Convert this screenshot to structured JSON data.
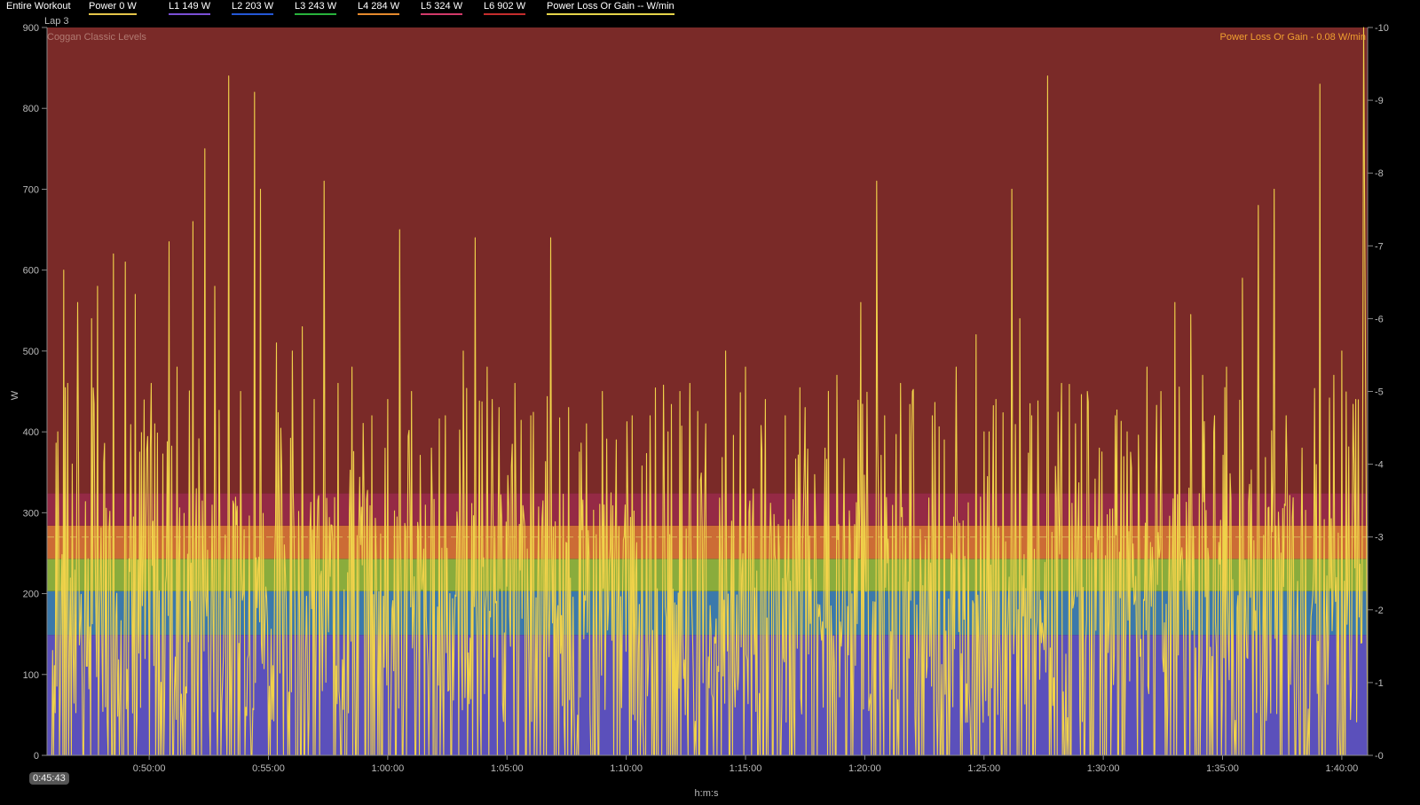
{
  "legend": {
    "title": "Entire Workout",
    "items": [
      {
        "label": "Power  0 W",
        "color": "#e5c54a"
      },
      {
        "label": "L1  149 W",
        "color": "#7a4fd6"
      },
      {
        "label": "L2  203 W",
        "color": "#2457d6"
      },
      {
        "label": "L3  243 W",
        "color": "#28b33c"
      },
      {
        "label": "L4  284 W",
        "color": "#e58a2d"
      },
      {
        "label": "L5  324 W",
        "color": "#d23a6a"
      },
      {
        "label": "L6  902 W",
        "color": "#c52d2d"
      },
      {
        "label": "Power Loss Or Gain  -- W/min",
        "color": "#e5d44a"
      }
    ]
  },
  "lap_label": "Lap 3",
  "zone_scheme_label": "Coggan Classic Levels",
  "secondary_label": "Power Loss Or Gain - 0.08 W/min",
  "cursor_time": "0:45:43",
  "chart_data": {
    "type": "line",
    "title": "",
    "xlabel": "h:m:s",
    "ylabel": "W",
    "xlim_seconds": [
      2743,
      6065
    ],
    "ylim": [
      0,
      900
    ],
    "y2lim": [
      0,
      10
    ],
    "yticks": [
      "0",
      "100",
      "200",
      "300",
      "400",
      "500",
      "600",
      "700",
      "800",
      "900"
    ],
    "y2ticks": [
      "0",
      "1",
      "2",
      "3",
      "4",
      "5",
      "6",
      "7",
      "8",
      "9",
      "10"
    ],
    "xticks": [
      {
        "label": "0:50:00",
        "t": 3000
      },
      {
        "label": "0:55:00",
        "t": 3300
      },
      {
        "label": "1:00:00",
        "t": 3600
      },
      {
        "label": "1:05:00",
        "t": 3900
      },
      {
        "label": "1:10:00",
        "t": 4200
      },
      {
        "label": "1:15:00",
        "t": 4500
      },
      {
        "label": "1:20:00",
        "t": 4800
      },
      {
        "label": "1:25:00",
        "t": 5100
      },
      {
        "label": "1:30:00",
        "t": 5400
      },
      {
        "label": "1:35:00",
        "t": 5700
      },
      {
        "label": "1:40:00",
        "t": 6000
      }
    ],
    "zones": [
      {
        "name": "L1",
        "from": 0,
        "to": 149,
        "color": "#5b50bb"
      },
      {
        "name": "L2",
        "from": 149,
        "to": 203,
        "color": "#3b79ab"
      },
      {
        "name": "L3",
        "from": 203,
        "to": 243,
        "color": "#8aac3c"
      },
      {
        "name": "L4",
        "from": 243,
        "to": 284,
        "color": "#cc6c35"
      },
      {
        "name": "L5",
        "from": 284,
        "to": 324,
        "color": "#952a45"
      },
      {
        "name": "L6",
        "from": 324,
        "to": 900,
        "color": "#7a2a28"
      }
    ],
    "reference_line": 270,
    "series": [
      {
        "name": "Power",
        "color": "#f0d24a",
        "peaks": [
          {
            "t": 2755,
            "v": 0
          },
          {
            "t": 2770,
            "v": 400
          },
          {
            "t": 2785,
            "v": 600
          },
          {
            "t": 2795,
            "v": 460
          },
          {
            "t": 2820,
            "v": 560
          },
          {
            "t": 2855,
            "v": 540
          },
          {
            "t": 2870,
            "v": 580
          },
          {
            "t": 2910,
            "v": 620
          },
          {
            "t": 2940,
            "v": 610
          },
          {
            "t": 2965,
            "v": 570
          },
          {
            "t": 3005,
            "v": 460
          },
          {
            "t": 3050,
            "v": 635
          },
          {
            "t": 3070,
            "v": 480
          },
          {
            "t": 3110,
            "v": 660
          },
          {
            "t": 3140,
            "v": 750
          },
          {
            "t": 3165,
            "v": 580
          },
          {
            "t": 3200,
            "v": 840
          },
          {
            "t": 3230,
            "v": 450
          },
          {
            "t": 3265,
            "v": 820
          },
          {
            "t": 3280,
            "v": 700
          },
          {
            "t": 3320,
            "v": 510
          },
          {
            "t": 3360,
            "v": 500
          },
          {
            "t": 3385,
            "v": 530
          },
          {
            "t": 3415,
            "v": 440
          },
          {
            "t": 3440,
            "v": 710
          },
          {
            "t": 3475,
            "v": 460
          },
          {
            "t": 3510,
            "v": 480
          },
          {
            "t": 3560,
            "v": 420
          },
          {
            "t": 3600,
            "v": 440
          },
          {
            "t": 3630,
            "v": 650
          },
          {
            "t": 3660,
            "v": 450
          },
          {
            "t": 3710,
            "v": 380
          },
          {
            "t": 3745,
            "v": 420
          },
          {
            "t": 3790,
            "v": 500
          },
          {
            "t": 3820,
            "v": 640
          },
          {
            "t": 3850,
            "v": 480
          },
          {
            "t": 3880,
            "v": 430
          },
          {
            "t": 3920,
            "v": 460
          },
          {
            "t": 3960,
            "v": 420
          },
          {
            "t": 4010,
            "v": 640
          },
          {
            "t": 4055,
            "v": 430
          },
          {
            "t": 4100,
            "v": 410
          },
          {
            "t": 4140,
            "v": 450
          },
          {
            "t": 4175,
            "v": 390
          },
          {
            "t": 4215,
            "v": 420
          },
          {
            "t": 4260,
            "v": 420
          },
          {
            "t": 4305,
            "v": 400
          },
          {
            "t": 4335,
            "v": 450
          },
          {
            "t": 4360,
            "v": 460
          },
          {
            "t": 4400,
            "v": 410
          },
          {
            "t": 4450,
            "v": 500
          },
          {
            "t": 4500,
            "v": 480
          },
          {
            "t": 4550,
            "v": 440
          },
          {
            "t": 4600,
            "v": 420
          },
          {
            "t": 4650,
            "v": 430
          },
          {
            "t": 4700,
            "v": 380
          },
          {
            "t": 4730,
            "v": 470
          },
          {
            "t": 4790,
            "v": 560
          },
          {
            "t": 4830,
            "v": 710
          },
          {
            "t": 4850,
            "v": 420
          },
          {
            "t": 4890,
            "v": 460
          },
          {
            "t": 4920,
            "v": 450
          },
          {
            "t": 4970,
            "v": 420
          },
          {
            "t": 5000,
            "v": 390
          },
          {
            "t": 5030,
            "v": 480
          },
          {
            "t": 5080,
            "v": 520
          },
          {
            "t": 5100,
            "v": 400
          },
          {
            "t": 5130,
            "v": 440
          },
          {
            "t": 5170,
            "v": 700
          },
          {
            "t": 5190,
            "v": 540
          },
          {
            "t": 5220,
            "v": 420
          },
          {
            "t": 5260,
            "v": 840
          },
          {
            "t": 5295,
            "v": 460
          },
          {
            "t": 5330,
            "v": 410
          },
          {
            "t": 5360,
            "v": 450
          },
          {
            "t": 5390,
            "v": 380
          },
          {
            "t": 5430,
            "v": 420
          },
          {
            "t": 5460,
            "v": 400
          },
          {
            "t": 5510,
            "v": 480
          },
          {
            "t": 5545,
            "v": 450
          },
          {
            "t": 5580,
            "v": 560
          },
          {
            "t": 5620,
            "v": 545
          },
          {
            "t": 5650,
            "v": 470
          },
          {
            "t": 5680,
            "v": 420
          },
          {
            "t": 5710,
            "v": 480
          },
          {
            "t": 5750,
            "v": 590
          },
          {
            "t": 5790,
            "v": 680
          },
          {
            "t": 5830,
            "v": 700
          },
          {
            "t": 5860,
            "v": 420
          },
          {
            "t": 5900,
            "v": 380
          },
          {
            "t": 5945,
            "v": 830
          },
          {
            "t": 5980,
            "v": 470
          },
          {
            "t": 6000,
            "v": 500
          },
          {
            "t": 6035,
            "v": 440
          },
          {
            "t": 6055,
            "v": 900
          }
        ]
      },
      {
        "name": "Power Loss Or Gain",
        "color": "#e5d44a",
        "values": []
      }
    ],
    "legend": "top",
    "grid": false
  }
}
